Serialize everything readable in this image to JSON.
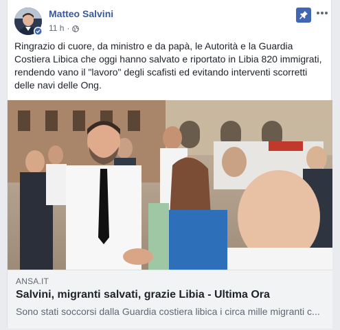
{
  "post": {
    "author": "Matteo Salvini",
    "time": "11 h",
    "separator": "·",
    "body": "Ringrazio di cuore, da ministro e da papà, le Autorità e la Guardia Costiera Libica che oggi hanno salvato e riportato in Libia 820 immigrati, rendendo vano il \"lavoro\" degli scafisti ed evitando interventi scorretti delle navi delle Ong."
  },
  "link_preview": {
    "domain": "ANSA.IT",
    "title": "Salvini, migranti salvati, grazie Libia - Ultima Ora",
    "description": "Sono stati soccorsi dalla Guardia costiera libica i circa mille migranti c..."
  },
  "icons": {
    "privacy": "globe-icon",
    "pin": "pin-icon",
    "options": "more-options-icon",
    "verified": "verified-badge-icon"
  },
  "colors": {
    "author_link": "#385898",
    "pin_bg": "#4267b2",
    "text": "#1d2129",
    "muted": "#606770",
    "link_bg": "#f2f3f5"
  }
}
